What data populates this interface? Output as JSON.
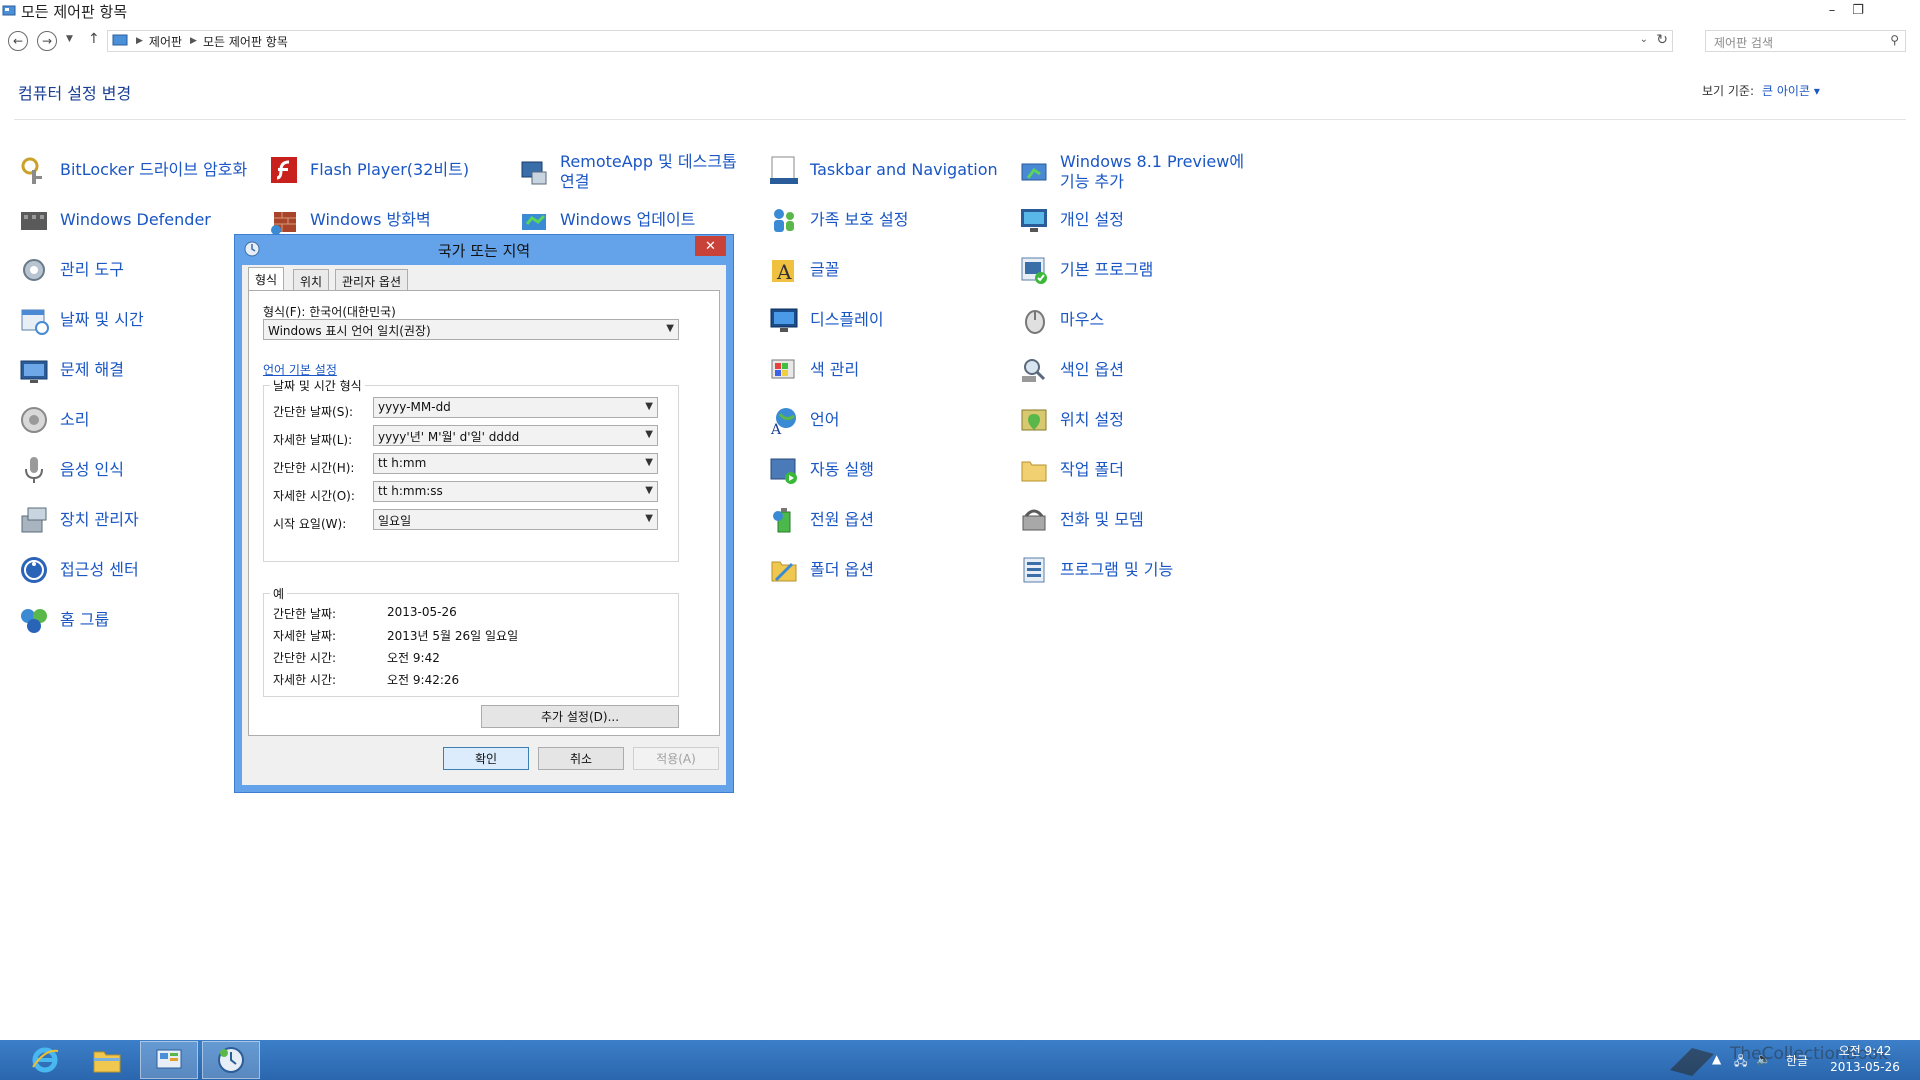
{
  "window": {
    "title": "모든 제어판 항목",
    "controls": [
      "minimize-button",
      "restore-button"
    ]
  },
  "address": {
    "crumbs": [
      "제어판",
      "모든 제어판 항목"
    ],
    "search_placeholder": "제어판 검색"
  },
  "header": {
    "title": "컴퓨터 설정 변경",
    "view_by_label": "보기 기준:",
    "view_by_value": "큰 아이콘 ▾"
  },
  "items": [
    {
      "label": "BitLocker 드라이브 암호화",
      "icon": "bitlocker-icon"
    },
    {
      "label": "Windows Defender",
      "icon": "defender-icon"
    },
    {
      "label": "관리 도구",
      "icon": "admin-tools-icon"
    },
    {
      "label": "날짜 및 시간",
      "icon": "date-time-icon"
    },
    {
      "label": "문제 해결",
      "icon": "troubleshoot-icon"
    },
    {
      "label": "소리",
      "icon": "sound-icon"
    },
    {
      "label": "음성 인식",
      "icon": "microphone-icon"
    },
    {
      "label": "장치 관리자",
      "icon": "device-manager-icon"
    },
    {
      "label": "접근성 센터",
      "icon": "accessibility-icon"
    },
    {
      "label": "홈 그룹",
      "icon": "homegroup-icon"
    },
    {
      "label": "Flash Player(32비트)",
      "icon": "flash-icon"
    },
    {
      "label": "Windows 방화벽",
      "icon": "firewall-icon"
    },
    {
      "label": "RemoteApp 및 데스크톱 연결",
      "icon": "remoteapp-icon"
    },
    {
      "label": "Windows 업데이트",
      "icon": "windows-update-icon"
    },
    {
      "label": "Taskbar and Navigation",
      "icon": "taskbar-icon"
    },
    {
      "label": "가족 보호 설정",
      "icon": "family-safety-icon"
    },
    {
      "label": "글꼴",
      "icon": "fonts-icon"
    },
    {
      "label": "디스플레이",
      "icon": "display-icon"
    },
    {
      "label": "색 관리",
      "icon": "color-management-icon"
    },
    {
      "label": "언어",
      "icon": "language-icon"
    },
    {
      "label": "자동 실행",
      "icon": "autoplay-icon"
    },
    {
      "label": "전원 옵션",
      "icon": "power-icon"
    },
    {
      "label": "폴더 옵션",
      "icon": "folder-options-icon"
    },
    {
      "label": "Windows 8.1 Preview에 기능 추가",
      "icon": "add-features-icon"
    },
    {
      "label": "개인 설정",
      "icon": "personalization-icon"
    },
    {
      "label": "기본 프로그램",
      "icon": "default-programs-icon"
    },
    {
      "label": "마우스",
      "icon": "mouse-icon"
    },
    {
      "label": "색인 옵션",
      "icon": "indexing-icon"
    },
    {
      "label": "위치 설정",
      "icon": "location-icon"
    },
    {
      "label": "작업 폴더",
      "icon": "work-folders-icon"
    },
    {
      "label": "전화 및 모뎀",
      "icon": "phone-modem-icon"
    },
    {
      "label": "프로그램 및 기능",
      "icon": "programs-features-icon"
    }
  ],
  "dialog": {
    "title": "국가 또는 지역",
    "close": "✕",
    "tabs": [
      "형식",
      "위치",
      "관리자 옵션"
    ],
    "format_label": "형식(F): 한국어(대한민국)",
    "format_value": "Windows 표시 언어 일치(권장)",
    "language_link": "언어 기본 설정",
    "datetime_group": "날짜 및 시간 형식",
    "fields": [
      {
        "label": "간단한 날짜(S):",
        "value": "yyyy-MM-dd"
      },
      {
        "label": "자세한 날짜(L):",
        "value": "yyyy'년' M'월' d'일' dddd"
      },
      {
        "label": "간단한 시간(H):",
        "value": "tt h:mm"
      },
      {
        "label": "자세한 시간(O):",
        "value": "tt h:mm:ss"
      },
      {
        "label": "시작 요일(W):",
        "value": "일요일"
      }
    ],
    "examples_group": "예",
    "examples": [
      {
        "label": "간단한 날짜:",
        "value": "2013-05-26"
      },
      {
        "label": "자세한 날짜:",
        "value": "2013년 5월 26일 일요일"
      },
      {
        "label": "간단한 시간:",
        "value": "오전 9:42"
      },
      {
        "label": "자세한 시간:",
        "value": "오전 9:42:26"
      }
    ],
    "more_settings": "추가 설정(D)...",
    "ok": "확인",
    "cancel": "취소",
    "apply": "적용(A)"
  },
  "taskbar": {
    "apps": [
      "internet-explorer-icon",
      "file-explorer-icon",
      "control-panel-icon",
      "region-settings-icon"
    ],
    "ime": "한글",
    "time": "오전 9:42",
    "date": "2013-05-26",
    "watermark": "TheCollectionBook"
  },
  "colors": {
    "link": "#1a56c4",
    "title": "#1a3e94",
    "dialog_frame": "#64a2ea",
    "taskbar": "#2a66ad",
    "close": "#c9423a"
  }
}
